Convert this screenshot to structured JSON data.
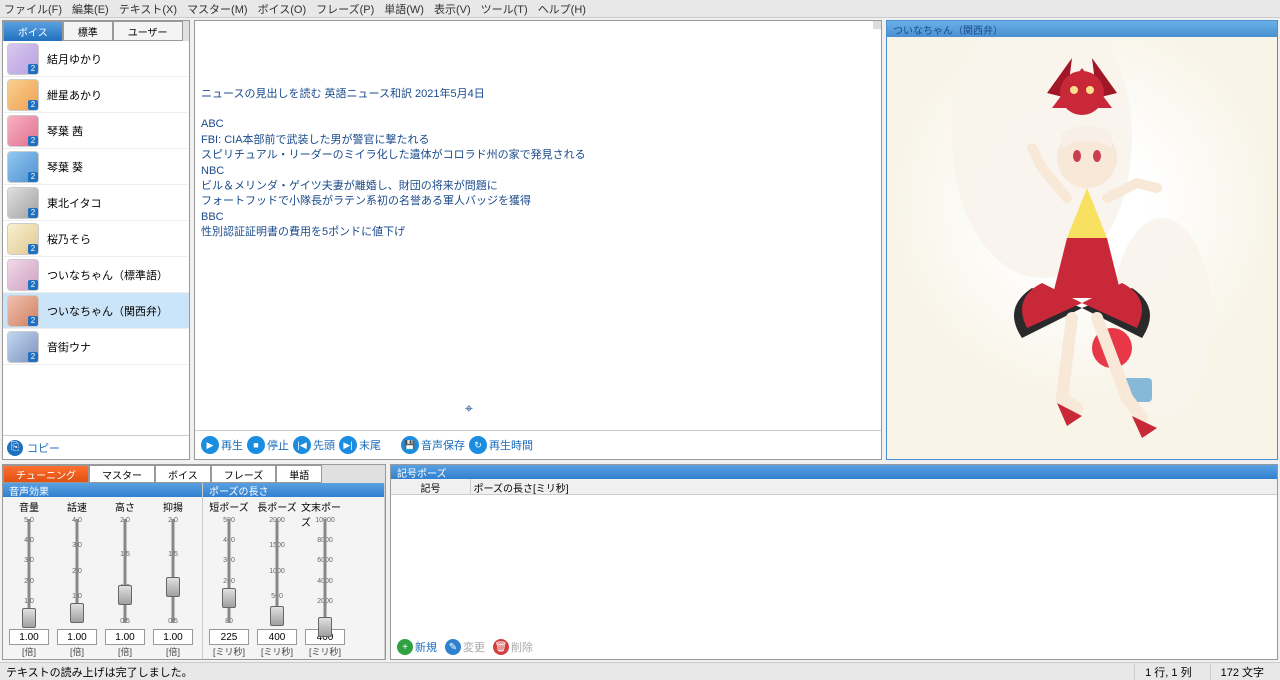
{
  "menu": [
    "ファイル(F)",
    "編集(E)",
    "テキスト(X)",
    "マスター(M)",
    "ボイス(O)",
    "フレーズ(P)",
    "単語(W)",
    "表示(V)",
    "ツール(T)",
    "ヘルプ(H)"
  ],
  "left_tabs": [
    "ボイス",
    "標準",
    "ユーザー"
  ],
  "voices": [
    {
      "name": "結月ゆかり",
      "avatar": "av1"
    },
    {
      "name": "紲星あかり",
      "avatar": "av2"
    },
    {
      "name": "琴葉 茜",
      "avatar": "av3"
    },
    {
      "name": "琴葉 葵",
      "avatar": "av4"
    },
    {
      "name": "東北イタコ",
      "avatar": "av5"
    },
    {
      "name": "桜乃そら",
      "avatar": "av6"
    },
    {
      "name": "ついなちゃん（標準語）",
      "avatar": "av7"
    },
    {
      "name": "ついなちゃん（関西弁）",
      "avatar": "av8"
    },
    {
      "name": "音街ウナ",
      "avatar": "av9"
    }
  ],
  "selected_voice_index": 7,
  "copy_label": "コピー",
  "editor_lines": [
    "ニュースの見出しを読む 英語ニュース和訳 2021年5月4日",
    "",
    "ABC",
    "FBI: CIA本部前で武装した男が警官に撃たれる",
    "スピリチュアル・リーダーのミイラ化した遺体がコロラド州の家で発見される",
    "NBC",
    "ビル＆メリンダ・ゲイツ夫妻が離婚し、財団の将来が問題に",
    "フォートフッドで小隊長がラテン系初の名誉ある軍人バッジを獲得",
    "BBC",
    "性別認証証明書の費用を5ポンドに値下げ"
  ],
  "play_controls": {
    "play": "再生",
    "stop": "停止",
    "head": "先頭",
    "tail": "末尾",
    "save_audio": "音声保存",
    "play_time": "再生時間"
  },
  "character_title": "ついなちゃん（関西弁）",
  "tuning_tabs": [
    "チューニング",
    "マスター",
    "ボイス",
    "フレーズ",
    "単語"
  ],
  "voice_effect_hdr": "音声効果",
  "pause_len_hdr": "ポーズの長さ",
  "sliders_effect": [
    {
      "label": "音量",
      "ticks": [
        "5.0",
        "4.0",
        "3.0",
        "2.0",
        "1.0",
        "0.0"
      ],
      "value": "1.00",
      "unit": "[倍]",
      "pos": 82
    },
    {
      "label": "話速",
      "ticks": [
        "4.0",
        "3.0",
        "2.0",
        "1.0",
        "0.5"
      ],
      "value": "1.00",
      "unit": "[倍]",
      "pos": 78
    },
    {
      "label": "高さ",
      "ticks": [
        "2.0",
        "1.5",
        "1.0",
        "0.5"
      ],
      "value": "1.00",
      "unit": "[倍]",
      "pos": 62
    },
    {
      "label": "抑揚",
      "ticks": [
        "2.0",
        "1.5",
        "1.0",
        "0.5"
      ],
      "value": "1.00",
      "unit": "[倍]",
      "pos": 55
    }
  ],
  "sliders_pause": [
    {
      "label": "短ポーズ",
      "ticks": [
        "500",
        "400",
        "300",
        "200",
        "100",
        "80"
      ],
      "value": "225",
      "unit": "[ミリ秒]",
      "pos": 65
    },
    {
      "label": "長ポーズ",
      "ticks": [
        "2000",
        "1500",
        "1000",
        "500",
        "100"
      ],
      "value": "400",
      "unit": "[ミリ秒]",
      "pos": 80
    },
    {
      "label": "文末ポーズ",
      "ticks": [
        "10000",
        "8000",
        "6000",
        "4000",
        "2000",
        "0"
      ],
      "value": "400",
      "unit": "[ミリ秒]",
      "pos": 90
    }
  ],
  "symbol_pause_hdr": "記号ポーズ",
  "symbol_cols": {
    "c1": "記号",
    "c2": "ポーズの長さ[ミリ秒]"
  },
  "symbol_btns": {
    "new": "新規",
    "edit": "変更",
    "delete": "削除"
  },
  "status": {
    "msg": "テキストの読み上げは完了しました。",
    "pos": "1 行, 1 列",
    "chars": "172 文字"
  }
}
